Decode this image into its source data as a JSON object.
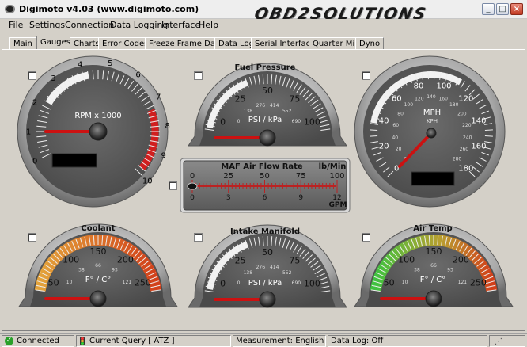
{
  "window": {
    "title": "Digimoto v4.03 (www.digimoto.com)",
    "brand": "OBD2SOLUTIONS",
    "minimize_glyph": "_",
    "maximize_glyph": "□",
    "close_glyph": "×"
  },
  "menu": [
    "File",
    "Settings",
    "Connection",
    "Data Logging",
    "Interface",
    "Help"
  ],
  "tabs": [
    "Main",
    "Gauges",
    "Charts",
    "Error Codes",
    "Freeze Frame Data",
    "Data Log",
    "Serial Interface",
    "Quarter Mile",
    "Dyno"
  ],
  "active_tab": "Gauges",
  "gauges": {
    "rpm": {
      "unit_label": "RPM x 1000",
      "ticks": [
        "0",
        "1",
        "2",
        "3",
        "4",
        "5",
        "6",
        "7",
        "8",
        "9",
        "10"
      ],
      "redline_from": 7
    },
    "fuel_pressure": {
      "title": "Fuel Pressure",
      "unit_label": "PSI / kPa",
      "outer_ticks": [
        "0",
        "25",
        "50",
        "75",
        "100"
      ],
      "inner_ticks": [
        "0",
        "138",
        "276",
        "414",
        "552",
        "690"
      ]
    },
    "speed": {
      "unit_label": "MPH",
      "sub_label": "KPH",
      "outer_ticks": [
        "0",
        "20",
        "40",
        "60",
        "80",
        "100",
        "120",
        "140",
        "160",
        "180"
      ],
      "inner_ticks": [
        "0",
        "20",
        "40",
        "60",
        "80",
        "100",
        "120",
        "140",
        "160",
        "180",
        "200",
        "220",
        "240",
        "260",
        "280"
      ]
    },
    "maf": {
      "title": "MAF Air Flow Rate",
      "unit_top": "lb/Min",
      "unit_bottom": "GPM",
      "top_ticks": [
        "0",
        "25",
        "50",
        "75",
        "100"
      ],
      "bottom_ticks": [
        "0",
        "3",
        "6",
        "9",
        "12"
      ]
    },
    "coolant": {
      "title": "Coolant",
      "unit_label": "F° / C°",
      "outer_ticks": [
        "50",
        "100",
        "150",
        "200",
        "250"
      ],
      "inner_ticks": [
        "10",
        "38",
        "66",
        "93",
        "121"
      ]
    },
    "intake_manifold": {
      "title": "Intake Manifold",
      "unit_label": "PSI / kPa",
      "outer_ticks": [
        "0",
        "25",
        "50",
        "75",
        "100"
      ],
      "inner_ticks": [
        "0",
        "138",
        "276",
        "414",
        "552",
        "690"
      ]
    },
    "air_temp": {
      "title": "Air Temp",
      "unit_label": "F° / C°",
      "outer_ticks": [
        "50",
        "100",
        "150",
        "200",
        "250"
      ],
      "inner_ticks": [
        "10",
        "38",
        "66",
        "93",
        "121"
      ]
    }
  },
  "status": {
    "connection": "Connected",
    "query": "Current Query [ ATZ ]",
    "measurement": "Measurement: English",
    "data_log": "Data Log: Off"
  },
  "colors": {
    "needle": "#cc1111",
    "gauge_face": "#595959",
    "gauge_bezel": "#9a9a9a",
    "redline": "#d01f1f",
    "cool_arc_start": "#e3a23a",
    "cool_arc_end": "#d2401a",
    "air_arc_start": "#3fc23f",
    "air_arc_end": "#d2401a"
  }
}
